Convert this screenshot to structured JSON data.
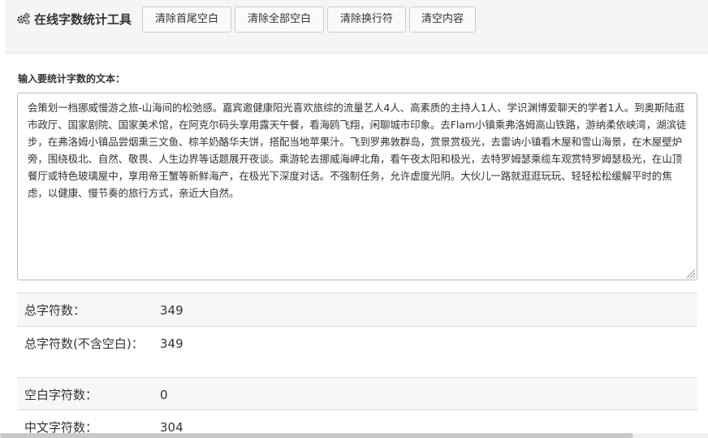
{
  "header": {
    "title": "在线字数统计工具",
    "icon": "gears-icon",
    "buttons": {
      "trim_ends": "清除首尾空白",
      "trim_all": "清除全部空白",
      "remove_newlines": "清除换行符",
      "clear_content": "清空内容"
    }
  },
  "input": {
    "label": "输入要统计字数的文本：",
    "text": "会策划一档挪威慢游之旅-山海间的松弛感。嘉宾邀健康阳光喜欢旅综的流量艺人4人、高素质的主持人1人、学识渊博爱聊天的学者1人。到奥斯陆逛市政厅、国家剧院、国家美术馆，在阿克尔码头享用露天午餐，看海鸥飞翔，闲聊城市印象。去Flam小镇乘弗洛姆高山铁路，游纳柔依峡湾，湖滨徒步，在弗洛姆小镇品尝烟熏三文鱼、棕羊奶酪华夫饼，搭配当地苹果汁。飞到罗弗敦群岛，赏景赏极光，去雷讷小镇看木屋和雪山海景，在木屋壁炉旁，围绕极北、自然、敬畏、人生边界等话题展开夜谈。乘游轮去挪威海岬北角，看午夜太阳和极光，去特罗姆瑟乘缆车观赏特罗姆瑟极光，在山顶餐厅或特色玻璃屋中，享用帝王蟹等新鲜海产，在极光下深度对话。不强制任务，允许虚度光阴。大伙儿一路就逛逛玩玩、轻轻松松缓解平时的焦虑，以健康、慢节奏的旅行方式，亲近大自然。"
  },
  "stats": [
    {
      "label": "总字符数：",
      "value": "349"
    },
    {
      "label": "总字符数(不含空白)：",
      "value": "349"
    },
    {
      "label": "空白字符数：",
      "value": "0"
    },
    {
      "label": "中文字符数：",
      "value": "304"
    }
  ]
}
